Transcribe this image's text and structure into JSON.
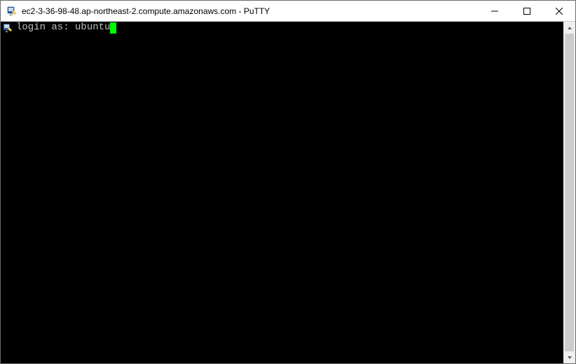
{
  "window": {
    "title": "ec2-3-36-98-48.ap-northeast-2.compute.amazonaws.com - PuTTY"
  },
  "terminal": {
    "prompt": "login as: ",
    "input": "ubuntu"
  }
}
